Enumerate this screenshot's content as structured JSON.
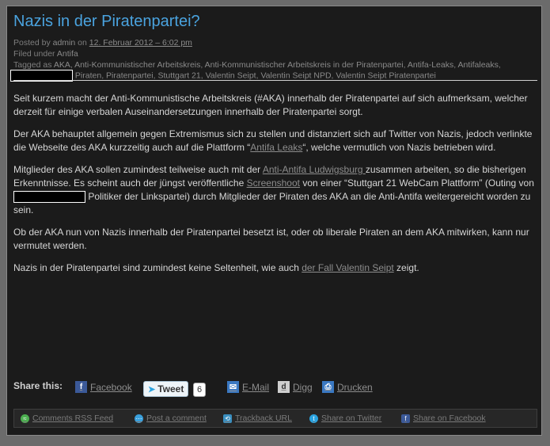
{
  "post": {
    "title": "Nazis in der Piratenpartei?",
    "posted_by_prefix": "Posted by",
    "author": "admin",
    "on": "on",
    "date": "12. Februar 2012 – 6:02 pm",
    "filed_prefix": "Filed under",
    "category": "Antifa",
    "tagged_prefix": "Tagged as",
    "tags_line1": [
      "AKA",
      "Anti-Kommunistischer Arbeitskreis",
      "Anti-Kommunistischer Arbeitskreis in der Piratenpartei",
      "Antifa-Leaks",
      "Antifaleaks"
    ],
    "tags_line2": [
      "Piraten",
      "Piratenpartei",
      "Stuttgart 21",
      "Valentin Seipt",
      "Valentin Seipt NPD",
      "Valentin Seipt Piratenpartei"
    ]
  },
  "content": {
    "p1": "Seit kurzem macht der Anti-Kommunistische Arbeitskreis (#AKA) innerhalb der Piratenpartei auf sich aufmerksam, welcher derzeit für einige verbalen Auseinandersetzungen innerhalb der Piratenpartei sorgt.",
    "p2_a": "Der AKA behauptet allgemein gegen Extremismus sich zu stellen und distanziert sich auf Twitter von Nazis, jedoch verlinkte die Webseite des AKA kurzzeitig auch auf die Plattform “",
    "p2_link": "Antifa Leaks",
    "p2_b": "“, welche vermutlich von Nazis betrieben wird.",
    "p3_a": "Mitglieder des AKA sollen zumindest teilweise auch mit der ",
    "p3_link1": "Anti-Antifa Ludwigsburg ",
    "p3_b": "zusammen arbeiten, so die bisherigen Erkenntnisse. Es scheint auch der jüngst veröffentliche ",
    "p3_link2": "Screenshoot",
    "p3_c": " von einer “Stuttgart 21 WebCam Plattform” (Outing von ",
    "p3_d": " Politiker der Linkspartei) durch Mitglieder der Piraten des AKA an die Anti-Antifa weitergereicht worden zu sein.",
    "p4": "Ob der AKA nun von Nazis innerhalb der Piratenpartei besetzt ist, oder ob liberale Piraten an dem AKA mitwirken, kann nur vermutet werden.",
    "p5_a": "Nazis in der Piratenpartei sind zumindest keine Seltenheit, wie auch ",
    "p5_link": "der Fall Valentin Seipt",
    "p5_b": " zeigt."
  },
  "share": {
    "label": "Share this:",
    "facebook": "Facebook",
    "tweet": "Tweet",
    "tweet_count": "6",
    "email": "E-Mail",
    "digg": "Digg",
    "print": "Drucken"
  },
  "footer": {
    "rss": "Comments RSS Feed",
    "comment": "Post a comment",
    "trackback": "Trackback URL",
    "twitter": "Share on Twitter",
    "facebook": "Share on Facebook"
  },
  "icons": [
    "facebook-icon",
    "twitter-bird-icon",
    "email-icon",
    "digg-icon",
    "print-icon",
    "rss-icon",
    "comment-icon",
    "trackback-icon",
    "twitter-icon"
  ],
  "colors": {
    "title": "#4aa3df",
    "background": "#1b1b1b",
    "link": "#8d8d8d",
    "text": "#d6d6d6"
  }
}
